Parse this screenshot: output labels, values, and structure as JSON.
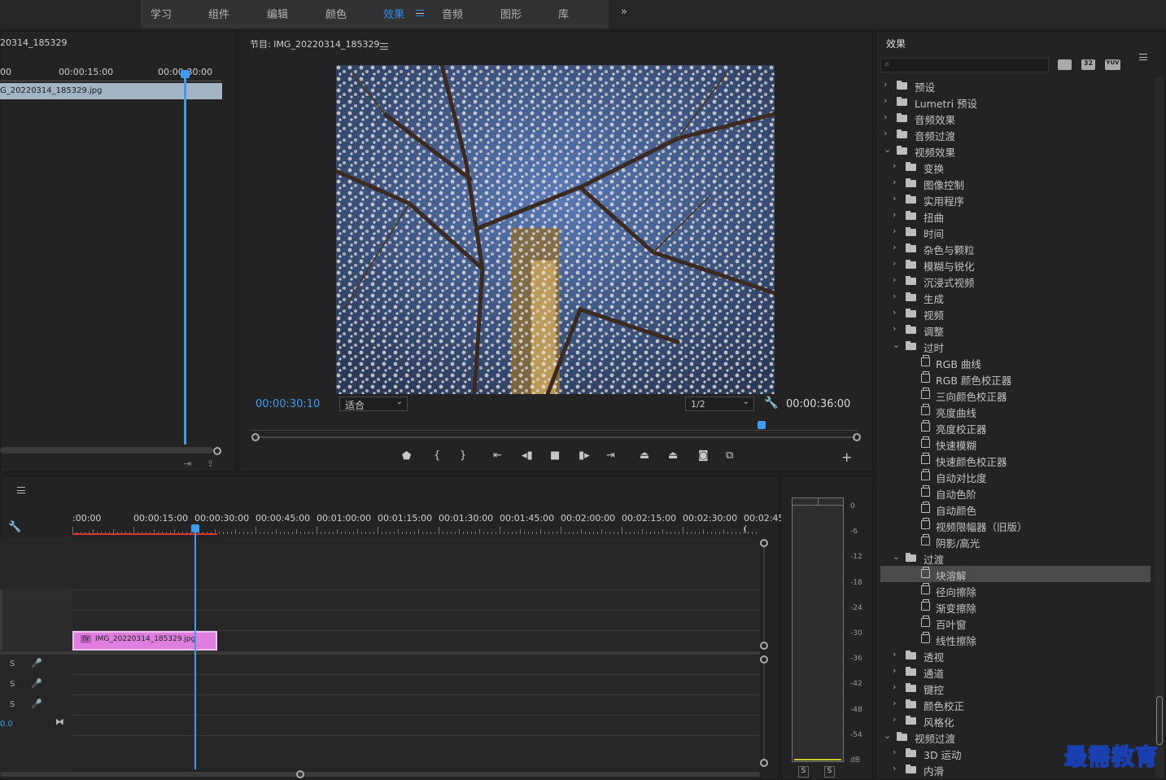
{
  "workspace": {
    "tabs": [
      "学习",
      "组件",
      "编辑",
      "颜色",
      "效果",
      "音频",
      "图形",
      "库"
    ],
    "active": "效果",
    "more": "»"
  },
  "source": {
    "title": "20314_185329",
    "time_labels": [
      "00",
      "00:00:15:00",
      "00:00:30:00"
    ],
    "clip": "G_20220314_185329.jpg"
  },
  "program": {
    "title": "节目: IMG_20220314_185329",
    "timecode": "00:00:30:10",
    "fit": "适合",
    "res": "1/2",
    "duration": "00:00:36:00",
    "colors": {
      "timecode": "#3d9bf0",
      "playhead": "#3d9bf0"
    }
  },
  "timeline": {
    "ruler": [
      ":00:00",
      "00:00:15:00",
      "00:00:30:00",
      "00:00:45:00",
      "00:01:00:00",
      "00:01:15:00",
      "00:01:30:00",
      "00:01:45:00",
      "00:02:00:00",
      "00:02:15:00",
      "00:02:30:00",
      "00:02:45:("
    ],
    "clip": "IMG_20220314_185329.jpg",
    "clip_fx": "fx",
    "track_s": [
      "S",
      "S",
      "S"
    ],
    "bottom_val": "0.0",
    "clip_color": "#e07ee0"
  },
  "meter": {
    "scale": [
      "0",
      "-6",
      "-12",
      "-18",
      "-24",
      "-30",
      "-36",
      "-42",
      "-48",
      "-54",
      "dB"
    ],
    "solo": [
      "S",
      "S"
    ]
  },
  "effects": {
    "title": "效果",
    "items": [
      {
        "t": "preset",
        "l": 0,
        "label": "预设",
        "open": false
      },
      {
        "t": "preset",
        "l": 0,
        "label": "Lumetri 预设",
        "open": false
      },
      {
        "t": "folder",
        "l": 0,
        "label": "音频效果",
        "open": false
      },
      {
        "t": "folder",
        "l": 0,
        "label": "音频过渡",
        "open": false
      },
      {
        "t": "folder",
        "l": 0,
        "label": "视频效果",
        "open": true
      },
      {
        "t": "folder",
        "l": 1,
        "label": "变换",
        "open": false
      },
      {
        "t": "folder",
        "l": 1,
        "label": "图像控制",
        "open": false
      },
      {
        "t": "folder",
        "l": 1,
        "label": "实用程序",
        "open": false
      },
      {
        "t": "folder",
        "l": 1,
        "label": "扭曲",
        "open": false
      },
      {
        "t": "folder",
        "l": 1,
        "label": "时间",
        "open": false
      },
      {
        "t": "folder",
        "l": 1,
        "label": "杂色与颗粒",
        "open": false
      },
      {
        "t": "folder",
        "l": 1,
        "label": "模糊与锐化",
        "open": false
      },
      {
        "t": "folder",
        "l": 1,
        "label": "沉浸式视频",
        "open": false
      },
      {
        "t": "folder",
        "l": 1,
        "label": "生成",
        "open": false
      },
      {
        "t": "folder",
        "l": 1,
        "label": "视频",
        "open": false
      },
      {
        "t": "folder",
        "l": 1,
        "label": "调整",
        "open": false
      },
      {
        "t": "folder",
        "l": 1,
        "label": "过时",
        "open": true
      },
      {
        "t": "fx",
        "l": 2,
        "label": "RGB 曲线"
      },
      {
        "t": "fx",
        "l": 2,
        "label": "RGB 颜色校正器"
      },
      {
        "t": "fx",
        "l": 2,
        "label": "三向颜色校正器"
      },
      {
        "t": "fx",
        "l": 2,
        "label": "亮度曲线"
      },
      {
        "t": "fx",
        "l": 2,
        "label": "亮度校正器"
      },
      {
        "t": "fx",
        "l": 2,
        "label": "快速模糊"
      },
      {
        "t": "fx",
        "l": 2,
        "label": "快速颜色校正器"
      },
      {
        "t": "fx",
        "l": 2,
        "label": "自动对比度"
      },
      {
        "t": "fx",
        "l": 2,
        "label": "自动色阶"
      },
      {
        "t": "fx",
        "l": 2,
        "label": "自动颜色"
      },
      {
        "t": "fx",
        "l": 2,
        "label": "视频限幅器（旧版）"
      },
      {
        "t": "fx",
        "l": 2,
        "label": "阴影/高光"
      },
      {
        "t": "folder",
        "l": 1,
        "label": "过渡",
        "open": true
      },
      {
        "t": "fx",
        "l": 2,
        "label": "块溶解",
        "selected": true
      },
      {
        "t": "fx",
        "l": 2,
        "label": "径向擦除"
      },
      {
        "t": "fx",
        "l": 2,
        "label": "渐变擦除"
      },
      {
        "t": "fx",
        "l": 2,
        "label": "百叶窗"
      },
      {
        "t": "fx",
        "l": 2,
        "label": "线性擦除"
      },
      {
        "t": "folder",
        "l": 1,
        "label": "透视",
        "open": false
      },
      {
        "t": "folder",
        "l": 1,
        "label": "通道",
        "open": false
      },
      {
        "t": "folder",
        "l": 1,
        "label": "键控",
        "open": false
      },
      {
        "t": "folder",
        "l": 1,
        "label": "颜色校正",
        "open": false
      },
      {
        "t": "folder",
        "l": 1,
        "label": "风格化",
        "open": false
      },
      {
        "t": "folder",
        "l": 0,
        "label": "视频过渡",
        "open": true
      },
      {
        "t": "folder",
        "l": 1,
        "label": "3D 运动",
        "open": false
      },
      {
        "t": "folder",
        "l": 1,
        "label": "内滑",
        "open": false
      }
    ],
    "icon_btns": [
      "32",
      "YUV"
    ]
  },
  "watermark": "最需教育"
}
